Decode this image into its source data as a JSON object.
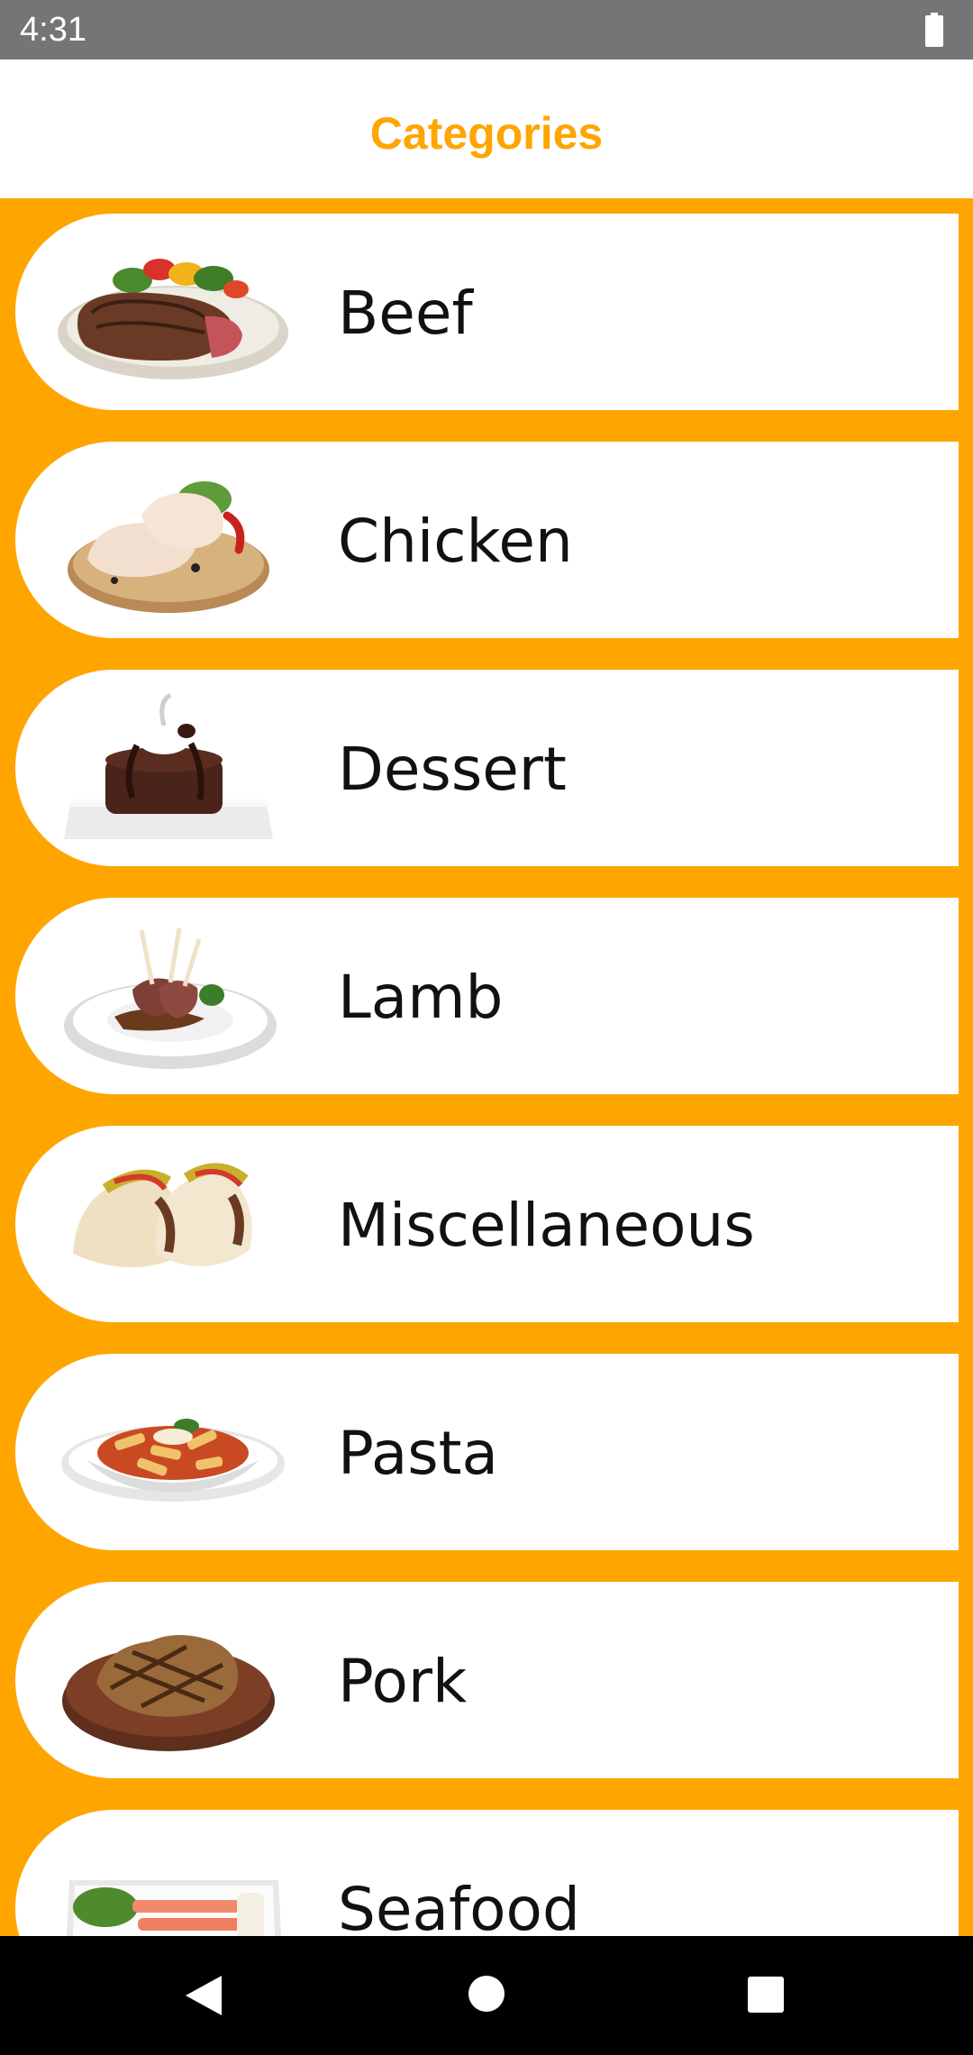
{
  "status_bar": {
    "time": "4:31",
    "battery_icon": "battery-full-icon"
  },
  "app_bar": {
    "title": "Categories"
  },
  "categories": [
    {
      "label": "Beef",
      "image": "beef-steak-image"
    },
    {
      "label": "Chicken",
      "image": "chicken-legs-image"
    },
    {
      "label": "Dessert",
      "image": "chocolate-cake-image"
    },
    {
      "label": "Lamb",
      "image": "lamb-chops-image"
    },
    {
      "label": "Miscellaneous",
      "image": "tacos-image"
    },
    {
      "label": "Pasta",
      "image": "penne-pasta-image"
    },
    {
      "label": "Pork",
      "image": "pork-chop-image"
    },
    {
      "label": "Seafood",
      "image": "salmon-plate-image"
    }
  ],
  "nav_bar": {
    "back": "back-icon",
    "home": "home-icon",
    "recents": "recents-icon"
  },
  "colors": {
    "accent": "#FFA500",
    "status_bar": "#757575",
    "card": "#FFFFFF",
    "nav_bar": "#000000"
  }
}
